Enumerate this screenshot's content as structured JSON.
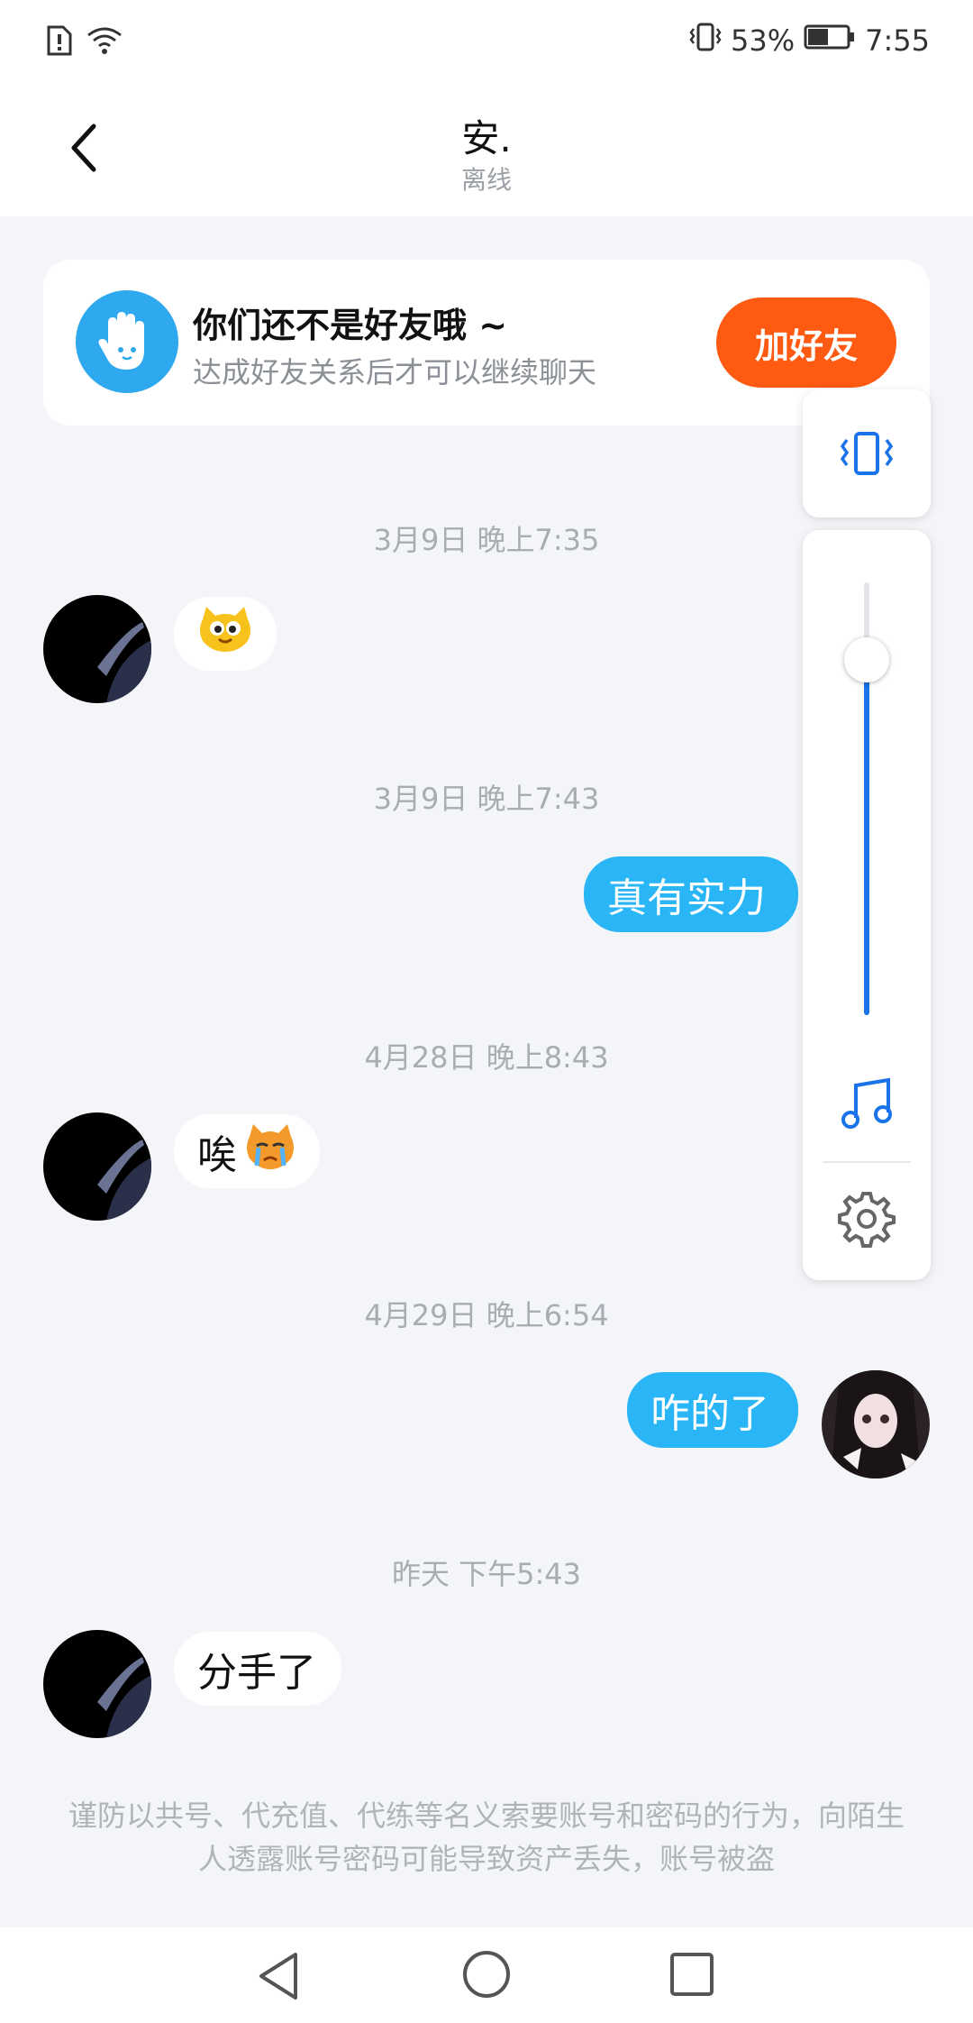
{
  "status_bar": {
    "battery_percent": "53%",
    "time": "7:55",
    "battery_level": 0.53
  },
  "header": {
    "title": "安.",
    "subtitle": "离线"
  },
  "friend_card": {
    "title": "你们还不是好友哦 ~",
    "subtitle": "达成好友关系后才可以继续聊天",
    "button_label": "加好友",
    "accent": "#ff5a12"
  },
  "messages": [
    {
      "timestamp": "3月9日 晚上7:35",
      "side": "in",
      "text": "",
      "emoji": "cat-smile-emoji"
    },
    {
      "timestamp": "3月9日 晚上7:43",
      "side": "out",
      "text": "真有实力"
    },
    {
      "timestamp": "4月28日 晚上8:43",
      "side": "in",
      "text": "唉",
      "emoji": "cat-cry-emoji"
    },
    {
      "timestamp": "4月29日 晚上6:54",
      "side": "out",
      "text": "咋的了"
    },
    {
      "timestamp": "昨天 下午5:43",
      "side": "in",
      "text": "分手了"
    }
  ],
  "volume_panel": {
    "level": 0.82,
    "icons": [
      "vibrate-icon",
      "music-note-icon",
      "settings-gear-icon"
    ]
  },
  "notice": {
    "text": "谨防以共号、代充值、代练等名义索要账号和密码的行为，向陌生人透露账号密码可能导致资产丢失，账号被盗"
  },
  "colors": {
    "bubble_out": "#2ab6f6",
    "bubble_in": "#ffffff",
    "background": "#f3f5f8",
    "slider": "#1a73e8"
  }
}
